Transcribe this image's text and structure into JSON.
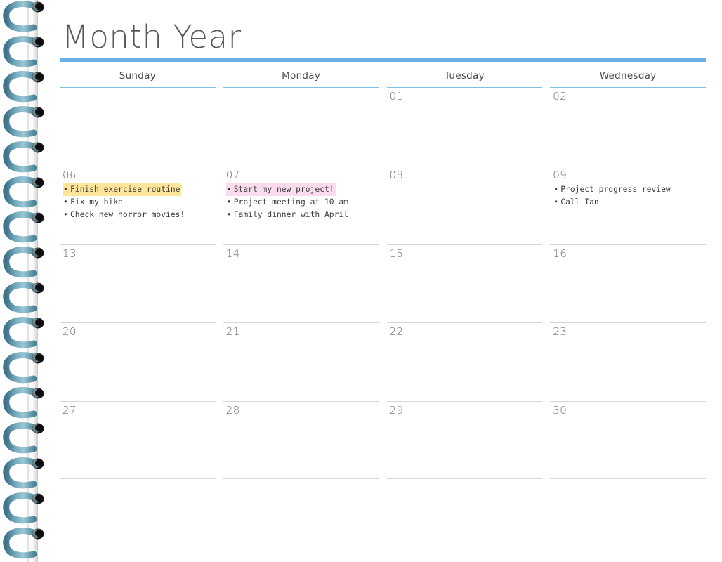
{
  "document": {
    "title": "Month Year",
    "type": "monthly-calendar-planner"
  },
  "theme": {
    "accent_blue": "#6aaee8",
    "header_underline": "#7cc0e4",
    "grid_line": "#d6d6d6",
    "title_color": "#595959",
    "date_color": "#6b6b6b",
    "event_color": "#3d3d3d",
    "highlight_yellow": "#ffe599",
    "highlight_pink": "#fadcee",
    "spiral_coil": "#5d91a8",
    "spiral_coil_light": "#8fbecd",
    "spiral_ring": "#1c1c1c",
    "spine": "#e2e2e2"
  },
  "calendar": {
    "day_headers": [
      "Sunday",
      "Monday",
      "Tuesday",
      "Wednesday"
    ],
    "weeks": [
      {
        "days": [
          {
            "date": "",
            "events": []
          },
          {
            "date": "",
            "events": []
          },
          {
            "date": "01",
            "events": []
          },
          {
            "date": "02",
            "events": []
          }
        ]
      },
      {
        "days": [
          {
            "date": "06",
            "events": [
              {
                "text": "Finish exercise routine",
                "highlight": "yellow"
              },
              {
                "text": "Fix my bike",
                "highlight": "none"
              },
              {
                "text": "Check new horror movies!",
                "highlight": "none"
              }
            ]
          },
          {
            "date": "07",
            "events": [
              {
                "text": "Start my new project!",
                "highlight": "pink"
              },
              {
                "text": "Project meeting at 10 am",
                "highlight": "none"
              },
              {
                "text": "Family dinner with April",
                "highlight": "none"
              }
            ]
          },
          {
            "date": "08",
            "events": []
          },
          {
            "date": "09",
            "events": [
              {
                "text": "Project progress review",
                "highlight": "none"
              },
              {
                "text": "Call Ian",
                "highlight": "none"
              }
            ]
          }
        ]
      },
      {
        "days": [
          {
            "date": "13",
            "events": []
          },
          {
            "date": "14",
            "events": []
          },
          {
            "date": "15",
            "events": []
          },
          {
            "date": "16",
            "events": []
          }
        ]
      },
      {
        "days": [
          {
            "date": "20",
            "events": []
          },
          {
            "date": "21",
            "events": []
          },
          {
            "date": "22",
            "events": []
          },
          {
            "date": "23",
            "events": []
          }
        ]
      },
      {
        "days": [
          {
            "date": "27",
            "events": []
          },
          {
            "date": "28",
            "events": []
          },
          {
            "date": "29",
            "events": []
          },
          {
            "date": "30",
            "events": []
          }
        ]
      }
    ]
  },
  "binding": {
    "icon": "spiral-binding",
    "coil_count": 16
  },
  "bullet_glyph": "•"
}
